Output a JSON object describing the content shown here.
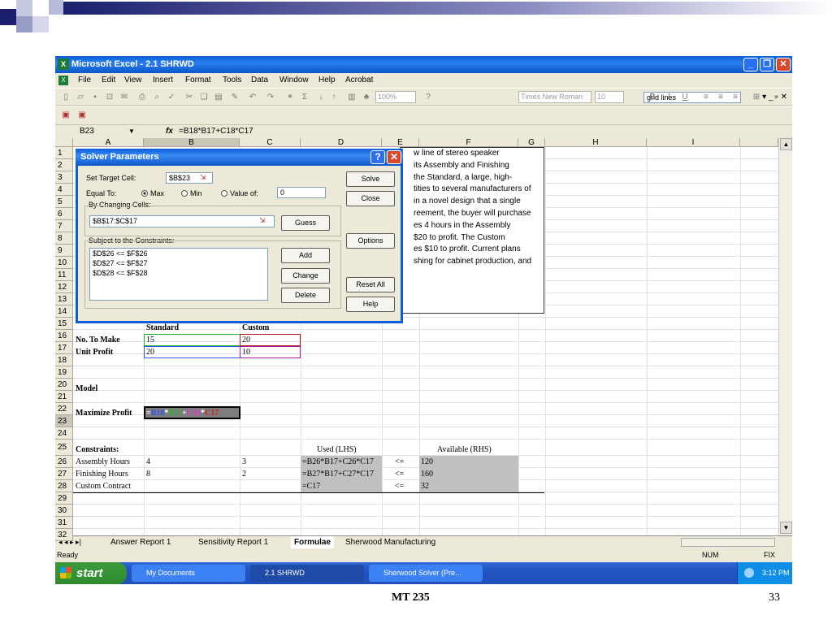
{
  "app": {
    "title": "Microsoft Excel - 2.1 SHRWD",
    "menu": [
      "File",
      "Edit",
      "View",
      "Insert",
      "Format",
      "Tools",
      "Data",
      "Window",
      "Help",
      "Acrobat"
    ],
    "help_box_value": "grid lines"
  },
  "toolbar": {
    "zoom": "100%",
    "font_name": "Times New Roman",
    "font_size": "10",
    "bold": "B",
    "italic": "I",
    "underline": "U"
  },
  "formula_bar": {
    "name_box": "B23",
    "fx": "fx",
    "formula": "=B18*B17+C18*C17"
  },
  "columns": [
    "A",
    "B",
    "C",
    "D",
    "E",
    "F",
    "G",
    "H",
    "I"
  ],
  "rows": [
    "1",
    "2",
    "3",
    "4",
    "5",
    "6",
    "7",
    "8",
    "9",
    "10",
    "11",
    "12",
    "13",
    "14",
    "15",
    "16",
    "17",
    "18",
    "19",
    "20",
    "21",
    "22",
    "23",
    "24",
    "25",
    "26",
    "27",
    "28",
    "29",
    "30",
    "31",
    "32"
  ],
  "cells": {
    "b16": "Standard",
    "c16": "Custom",
    "a17": "No. To Make",
    "b17": "15",
    "c17": "20",
    "a18": "Unit Profit",
    "b18": "20",
    "c18": "10",
    "a21": "Model",
    "a23": "Maximize Profit",
    "b23_parts": [
      "=",
      "B18",
      "*",
      "B17",
      "+",
      "C18",
      "*",
      "C17"
    ],
    "a25": "Constraints:",
    "d25": "Used (LHS)",
    "f25": "Available (RHS)",
    "a26": "Assembly Hours",
    "b26": "4",
    "c26": "3",
    "d26": "=B26*B17+C26*C17",
    "e26": "<=",
    "f26": "120",
    "a27": "Finishing Hours",
    "b27": "8",
    "c27": "2",
    "d27": "=B27*B17+C27*C17",
    "e27": "<=",
    "f27": "160",
    "a28": "Custom Contract",
    "d28": "=C17",
    "e28": "<=",
    "f28": "32"
  },
  "textbox_lines": [
    "w line of stereo speaker",
    "its Assembly and Finishing",
    "the Standard, a large, high-",
    "tities to several manufacturers of",
    "in a novel design that a single",
    "reement, the buyer will purchase",
    "es 4 hours in the Assembly",
    "$20 to profit.  The Custom",
    "es $10 to profit.  Current plans",
    "shing for cabinet production, and"
  ],
  "solver": {
    "title": "Solver Parameters",
    "set_target_label": "Set Target Cell:",
    "target_cell": "$B$23",
    "equal_to_label": "Equal To:",
    "max_label": "Max",
    "min_label": "Min",
    "value_of_label": "Value of:",
    "value_of": "0",
    "changing_label": "By Changing Cells:",
    "changing_cells": "$B$17:$C$17",
    "constraints_label": "Subject to the Constraints:",
    "constraints": [
      "$D$26 <= $F$26",
      "$D$27 <= $F$27",
      "$D$28 <= $F$28"
    ],
    "buttons": {
      "solve": "Solve",
      "close": "Close",
      "guess": "Guess",
      "options": "Options",
      "add": "Add",
      "change": "Change",
      "delete": "Delete",
      "reset": "Reset All",
      "help": "Help"
    }
  },
  "sheet_tabs": [
    "Answer Report 1",
    "Sensitivity Report 1",
    "Formulae",
    "Sherwood Manufacturing"
  ],
  "active_tab": "Formulae",
  "status": {
    "left": "Ready",
    "num": "NUM",
    "fix": "FIX"
  },
  "taskbar": {
    "start": "start",
    "items": [
      "My Documents",
      "2.1 SHRWD",
      "Sherwood Solver (Pre..."
    ],
    "clock": "3:12 PM"
  },
  "slide": {
    "footer": "MT 235",
    "page": "33"
  },
  "colors": {
    "accent": "#0a5fd8",
    "slide_bar": "#1b1f6e",
    "b_blue": "#1f3fbf",
    "b_green": "#1f8a2a",
    "b_magenta": "#b0159a",
    "b_red": "#b31b1b"
  }
}
